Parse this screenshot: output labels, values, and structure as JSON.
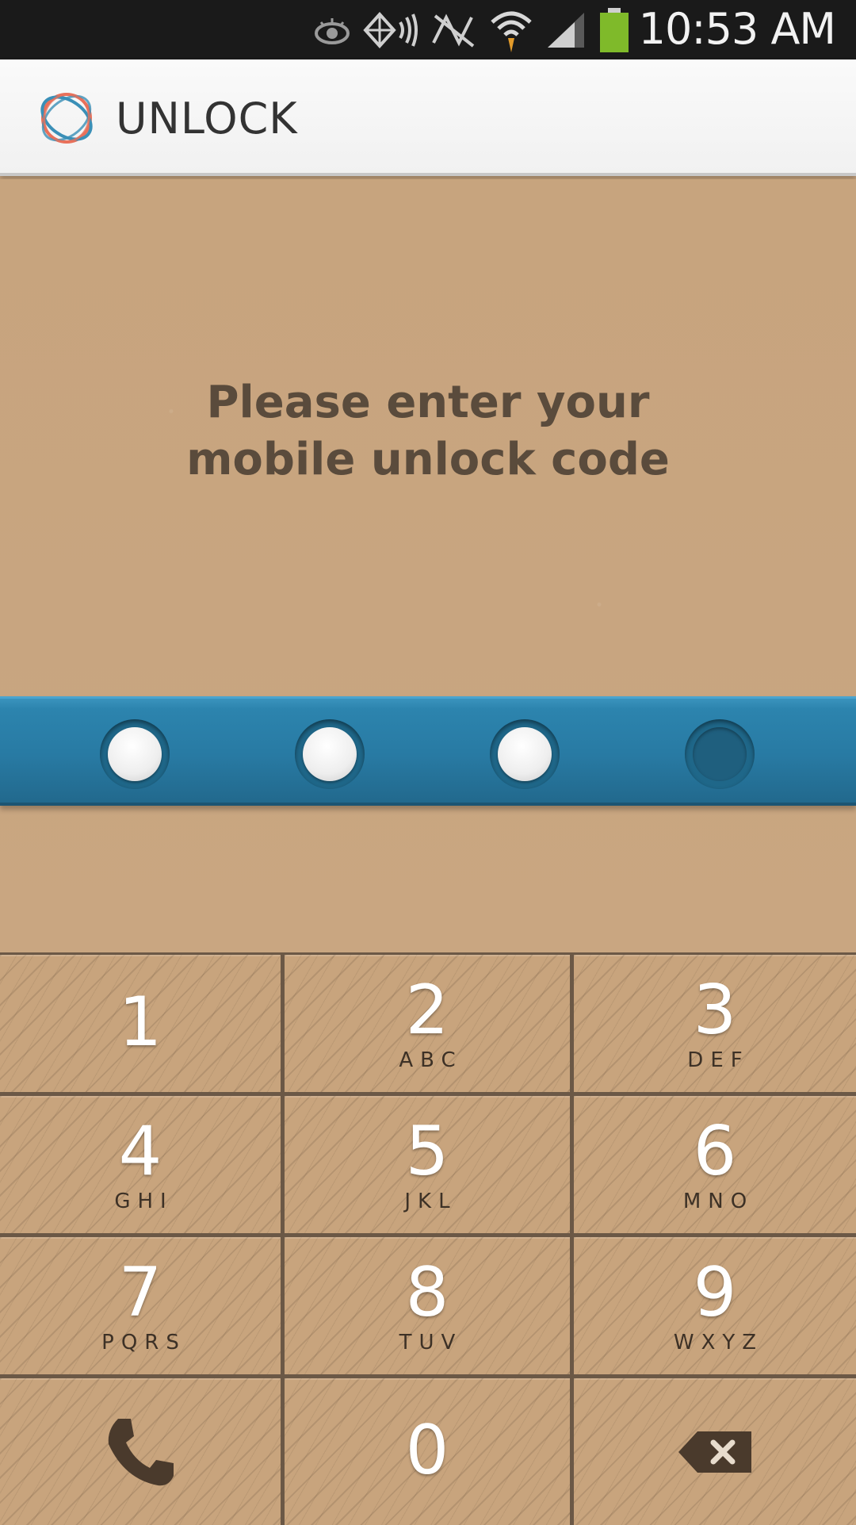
{
  "status_bar": {
    "time": "10:53 AM",
    "icons": [
      "eye-icon",
      "nfc-icon",
      "no-signal-icon",
      "wifi-icon",
      "signal-icon",
      "battery-icon"
    ],
    "battery_color": "#7fba2a"
  },
  "app_bar": {
    "title": "UNLOCK",
    "logo_colors": [
      "#e8705a",
      "#3a8fb7"
    ]
  },
  "prompt": {
    "line1": "Please enter your",
    "line2": "mobile unlock code"
  },
  "pin": {
    "length": 4,
    "entered": 3,
    "band_color": "#287aa3"
  },
  "keypad": {
    "keys": [
      {
        "digit": "1",
        "letters": ""
      },
      {
        "digit": "2",
        "letters": "ABC"
      },
      {
        "digit": "3",
        "letters": "DEF"
      },
      {
        "digit": "4",
        "letters": "GHI"
      },
      {
        "digit": "5",
        "letters": "JKL"
      },
      {
        "digit": "6",
        "letters": "MNO"
      },
      {
        "digit": "7",
        "letters": "PQRS"
      },
      {
        "digit": "8",
        "letters": "TUV"
      },
      {
        "digit": "9",
        "letters": "WXYZ"
      },
      {
        "icon": "phone-icon"
      },
      {
        "digit": "0",
        "letters": ""
      },
      {
        "icon": "backspace-icon"
      }
    ]
  }
}
